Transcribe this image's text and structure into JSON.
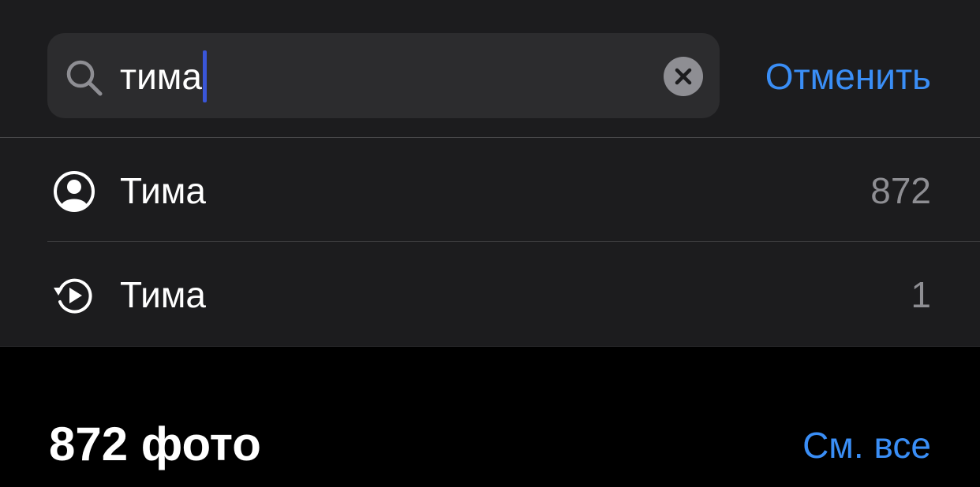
{
  "search": {
    "query": "тима",
    "cancel_label": "Отменить"
  },
  "suggestions": [
    {
      "icon": "person-circle-icon",
      "label": "Тима",
      "count": "872"
    },
    {
      "icon": "memory-replay-icon",
      "label": "Тима",
      "count": "1"
    }
  ],
  "results": {
    "title": "872 фото",
    "see_all_label": "См. все"
  },
  "colors": {
    "accent": "#3a8ef6",
    "background": "#000000",
    "panel": "#1c1c1e",
    "field": "#2c2c2e",
    "secondary_text": "#8e8e93",
    "caret": "#3a56d8"
  }
}
